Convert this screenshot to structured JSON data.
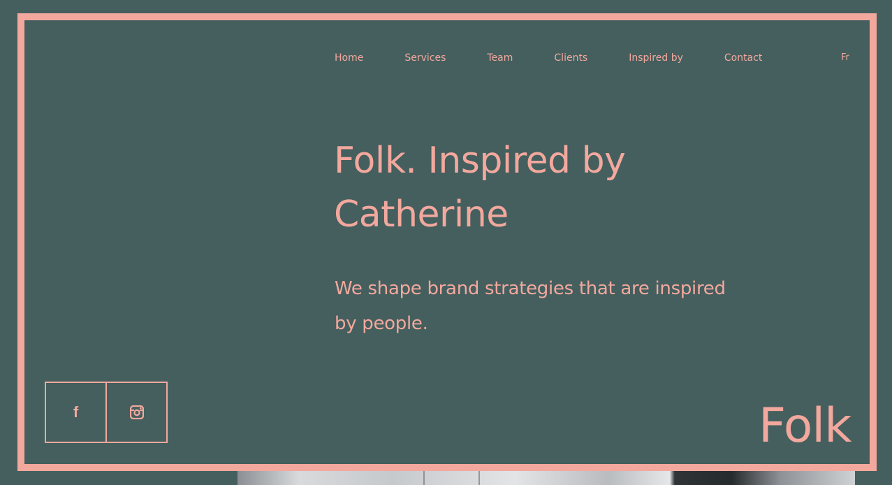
{
  "nav": {
    "items": [
      {
        "label": "Home"
      },
      {
        "label": "Services"
      },
      {
        "label": "Team"
      },
      {
        "label": "Clients"
      },
      {
        "label": "Inspired by"
      },
      {
        "label": "Contact"
      }
    ],
    "language_toggle": "Fr"
  },
  "hero": {
    "title_line1": "Folk. Inspired by",
    "title_line2": "Catherine",
    "subtitle_line1": "We shape brand strategies that are inspired",
    "subtitle_line2": "by people."
  },
  "social": {
    "facebook_icon": "facebook-icon",
    "instagram_icon": "instagram-icon"
  },
  "logo": {
    "text": "Folk"
  },
  "colors": {
    "background": "#445f5e",
    "accent": "#f3a89e"
  }
}
